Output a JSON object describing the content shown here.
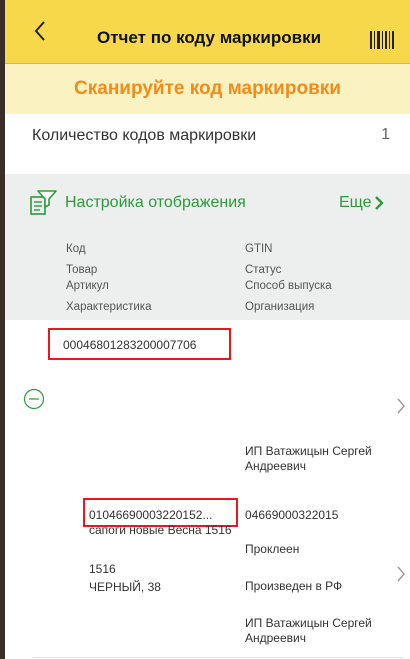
{
  "header": {
    "back_icon": "chevron-left-icon",
    "title": "Отчет по коду маркировки",
    "barcode_icon": "barcode-icon"
  },
  "scan_banner": {
    "text": "Сканируйте код маркировки"
  },
  "count": {
    "label": "Количество кодов маркировки",
    "value": "1"
  },
  "settings": {
    "icon": "filter-settings-icon",
    "label": "Настройка отображения",
    "more_label": "Еще",
    "more_icon": "chevron-right-icon"
  },
  "columns": {
    "left": [
      "Код",
      "Товар",
      "Артикул",
      "Характеристика"
    ],
    "right": [
      "GTIN",
      "Статус",
      "Способ выпуска",
      "Организация"
    ]
  },
  "rows": [
    {
      "code": "00046801283200007706",
      "expand_icon": "collapse-minus-icon",
      "chevron_icon": "chevron-right-icon"
    },
    {
      "organization_top": "ИП Ватажицын Сергей Андреевич",
      "code": "01046690003220152...",
      "gtin": "04669000322015",
      "product": "сапоги новые Весна 1516",
      "article": "1516",
      "characteristic": "ЧЕРНЫЙ, 38",
      "status": "Проклеен",
      "release_method": "Произведен в РФ",
      "organization": "ИП Ватажицын Сергей Андреевич",
      "chevron_icon": "chevron-right-icon"
    }
  ],
  "colors": {
    "header_bg": "#f6d84a",
    "banner_bg": "#fbf2c1",
    "banner_text": "#f08c1e",
    "accent_green": "#2e9a3c",
    "highlight_red": "#e8191e",
    "header_row_bg": "#ecefed"
  }
}
